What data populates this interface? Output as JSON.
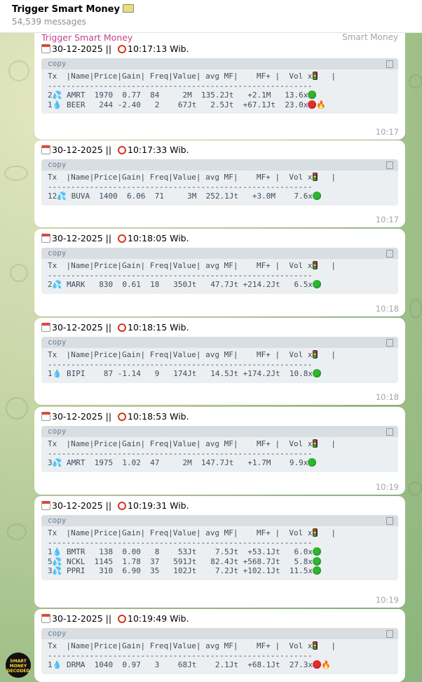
{
  "header": {
    "channel_name": "Trigger Smart Money",
    "subscribers": "54,539 messages"
  },
  "first_message": {
    "sender": "Trigger Smart Money",
    "admin_label": "Smart Money"
  },
  "code_header": "Tx  |Name|Price|Gain| Freq|Value| avg MF|    MF+ |  Vol x",
  "code_rule": "---------------------------------------------------------",
  "copy_label": "copy",
  "avatar_text": "SMART MONEY DECODED",
  "messages": [
    {
      "date": "30-12-2025 || ",
      "time_label": "10:17:13 Wib.",
      "footer_time": "10:17",
      "rows": [
        {
          "tx": "2",
          "icon": "splash",
          "text": " AMRT  1970  0.77  84     2M  135.2Jt   +2.1M   13.6x",
          "status": "green",
          "fire": false
        },
        {
          "tx": "1",
          "icon": "drop",
          "text": " BEER   244 -2.40   2    67Jt   2.5Jt  +67.1Jt  23.0x",
          "status": "red",
          "fire": true
        }
      ]
    },
    {
      "date": "30-12-2025 || ",
      "time_label": "10:17:33 Wib.",
      "footer_time": "10:17",
      "rows": [
        {
          "tx": "12",
          "icon": "splash",
          "text": " BUVA  1400  6.06  71     3M  252.1Jt   +3.0M    7.6x",
          "status": "green",
          "fire": false
        }
      ]
    },
    {
      "date": "30-12-2025 || ",
      "time_label": "10:18:05 Wib.",
      "footer_time": "10:18",
      "rows": [
        {
          "tx": "2",
          "icon": "splash",
          "text": " MARK   830  0.61  18   350Jt   47.7Jt +214.2Jt   6.5x",
          "status": "green",
          "fire": false
        }
      ]
    },
    {
      "date": "30-12-2025 || ",
      "time_label": "10:18:15 Wib.",
      "footer_time": "10:18",
      "rows": [
        {
          "tx": "1",
          "icon": "drop",
          "text": " BIPI    87 -1.14   9   174Jt   14.5Jt +174.2Jt  10.8x",
          "status": "green",
          "fire": false
        }
      ]
    },
    {
      "date": "30-12-2025 || ",
      "time_label": "10:18:53 Wib.",
      "footer_time": "10:19",
      "rows": [
        {
          "tx": "3",
          "icon": "splash",
          "text": " AMRT  1975  1.02  47     2M  147.7Jt   +1.7M    9.9x",
          "status": "green",
          "fire": false
        }
      ]
    },
    {
      "date": "30-12-2025 || ",
      "time_label": "10:19:31 Wib.",
      "footer_time": "10:19",
      "rows": [
        {
          "tx": "1",
          "icon": "drop",
          "text": " BMTR   138  0.00   8    53Jt    7.5Jt  +53.1Jt   6.0x",
          "status": "green",
          "fire": false
        },
        {
          "tx": "5",
          "icon": "splash",
          "text": " NCKL  1145  1.78  37   591Jt   82.4Jt +568.7Jt   5.8x",
          "status": "green",
          "fire": false
        },
        {
          "tx": "3",
          "icon": "splash",
          "text": " PPRI   310  6.90  35   102Jt    7.2Jt +102.1Jt  11.5x",
          "status": "green",
          "fire": false
        }
      ]
    },
    {
      "date": "30-12-2025 || ",
      "time_label": "10:19:49 Wib.",
      "footer_time": "",
      "rows": [
        {
          "tx": "1",
          "icon": "drop",
          "text": " DRMA  1040  0.97   3    68Jt    2.1Jt  +68.1Jt  27.3x",
          "status": "red",
          "fire": true
        }
      ]
    }
  ]
}
